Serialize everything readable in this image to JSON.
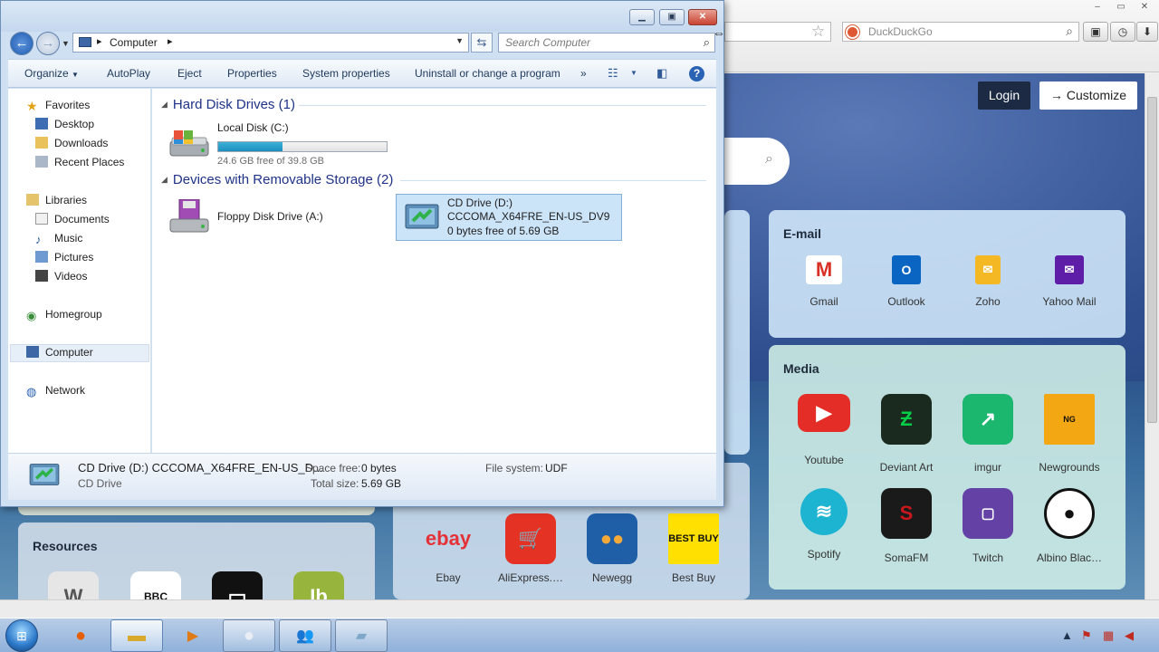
{
  "browser": {
    "search_placeholder": "DuckDuckGo",
    "login_label": "Login",
    "customize_label": "Customize",
    "panels": {
      "email": {
        "title": "E-mail",
        "tiles": [
          {
            "label": "Gmail",
            "icon": "gmail-icon",
            "color": "#ffffff"
          },
          {
            "label": "Outlook",
            "icon": "outlook-icon",
            "color": "#0a64c2"
          },
          {
            "label": "Zoho",
            "icon": "zoho-icon",
            "color": "#f4b825"
          },
          {
            "label": "Yahoo Mail",
            "icon": "yahoo-mail-icon",
            "color": "#5f1ea8"
          }
        ]
      },
      "media": {
        "title": "Media",
        "tiles": [
          {
            "label": "Youtube",
            "icon": "youtube-icon",
            "color": "#e52d27"
          },
          {
            "label": "Deviant Art",
            "icon": "deviantart-icon",
            "color": "#1b2a1f"
          },
          {
            "label": "imgur",
            "icon": "imgur-icon",
            "color": "#1bb76e"
          },
          {
            "label": "Newgrounds",
            "icon": "newgrounds-icon",
            "color": "#f3a712"
          },
          {
            "label": "Spotify",
            "icon": "spotify-icon",
            "color": "#1db4d2"
          },
          {
            "label": "SomaFM",
            "icon": "somafm-icon",
            "color": "#c9171e"
          },
          {
            "label": "Twitch",
            "icon": "twitch-icon",
            "color": "#6441a5"
          },
          {
            "label": "Albino Blac…",
            "icon": "albino-blacksheep-icon",
            "color": "#111111"
          }
        ]
      },
      "shopping": {
        "tiles": [
          {
            "label": "Ebay",
            "icon": "ebay-icon",
            "color": "#ffffff"
          },
          {
            "label": "AliExpress.…",
            "icon": "aliexpress-icon",
            "color": "#e43225"
          },
          {
            "label": "Newegg",
            "icon": "newegg-icon",
            "color": "#1f5fa8"
          },
          {
            "label": "Best Buy",
            "icon": "bestbuy-icon",
            "color": "#ffe000"
          }
        ]
      },
      "resources": {
        "title": "Resources",
        "tiles": [
          {
            "label": "",
            "icon": "wikipedia-icon",
            "color": "#e6e6e6"
          },
          {
            "label": "",
            "icon": "bbc-icon",
            "color": "#ffffff"
          },
          {
            "label": "",
            "icon": "resource-icon",
            "color": "#111111"
          },
          {
            "label": "",
            "icon": "instructables-icon",
            "color": "#97b53c"
          }
        ]
      }
    }
  },
  "explorer": {
    "address": "Computer",
    "search_placeholder": "Search Computer",
    "commands": {
      "organize": "Organize",
      "autoplay": "AutoPlay",
      "eject": "Eject",
      "properties": "Properties",
      "system_properties": "System properties",
      "uninstall": "Uninstall or change a program",
      "more": "»"
    },
    "nav": {
      "favorites": "Favorites",
      "desktop": "Desktop",
      "downloads": "Downloads",
      "recent": "Recent Places",
      "libraries": "Libraries",
      "documents": "Documents",
      "music": "Music",
      "pictures": "Pictures",
      "videos": "Videos",
      "homegroup": "Homegroup",
      "computer": "Computer",
      "network": "Network"
    },
    "groups": {
      "hard_disks": "Hard Disk Drives (1)",
      "removable": "Devices with Removable Storage (2)"
    },
    "drives": {
      "local": {
        "name": "Local Disk (C:)",
        "free": "24.6 GB free of 39.8 GB",
        "used_fraction": 0.38
      },
      "floppy": {
        "name": "Floppy Disk Drive (A:)"
      },
      "cd": {
        "name": "CD Drive (D:)",
        "label": "CCCOMA_X64FRE_EN-US_DV9",
        "free": "0 bytes free of 5.69 GB"
      }
    },
    "details": {
      "title": "CD Drive (D:) CCCOMA_X64FRE_EN-US_D...",
      "type": "CD Drive",
      "space_free_label": "Space free:",
      "space_free": "0 bytes",
      "total_size_label": "Total size:",
      "total_size": "5.69 GB",
      "fs_label": "File system:",
      "fs": "UDF"
    }
  }
}
